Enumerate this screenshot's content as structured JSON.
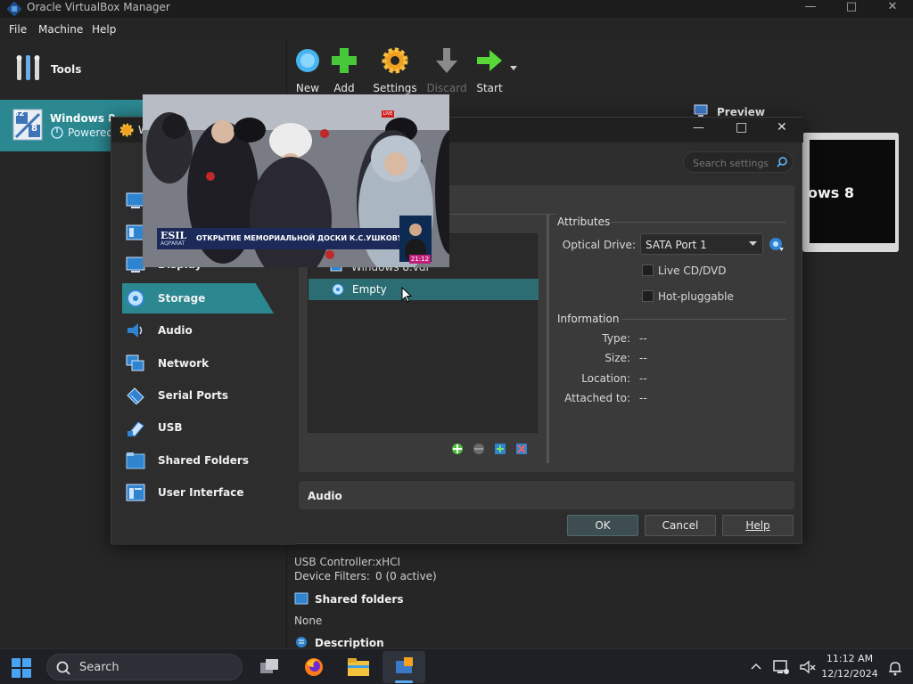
{
  "window": {
    "title": "Oracle VirtualBox Manager",
    "minimize_icon": "minimize-icon",
    "maximize_icon": "maximize-icon",
    "close_icon": "close-icon"
  },
  "menu": {
    "file": "File",
    "machine": "Machine",
    "help": "Help"
  },
  "left": {
    "tools_label": "Tools",
    "vm_name": "Windows 8",
    "vm_state": "Powered",
    "vm_badge_top": "32",
    "vm_badge_bottom": "8"
  },
  "toolbar": {
    "new": "New",
    "add": "Add",
    "settings": "Settings",
    "discard": "Discard",
    "start": "Start"
  },
  "preview": {
    "label": "Preview",
    "screen_text": "ows 8"
  },
  "details": {
    "usb_controller_label": "USB Controller:",
    "usb_controller_value": "xHCI",
    "device_filters_label": "Device Filters:",
    "device_filters_value": "0 (0 active)",
    "shared_folders_head": "Shared folders",
    "shared_folders_value": "None",
    "description_head": "Description"
  },
  "dialog": {
    "title_partial": "W",
    "search_placeholder": "Search settings",
    "mode_button_partial": "B",
    "nav": {
      "display": "Display",
      "storage": "Storage",
      "audio": "Audio",
      "network": "Network",
      "serial_ports": "Serial Ports",
      "usb": "USB",
      "shared_folders": "Shared Folders",
      "user_interface": "User Interface"
    },
    "storage": {
      "tree_item_disk": "Windows 8.vdi",
      "tree_item_empty": "Empty",
      "attributes_head": "Attributes",
      "optical_drive_label": "Optical Drive:",
      "optical_drive_value": "SATA Port 1",
      "live_cd_label": "Live CD/DVD",
      "hot_pluggable_label": "Hot-pluggable",
      "information_head": "Information",
      "type_label": "Type:",
      "type_value": "--",
      "size_label": "Size:",
      "size_value": "--",
      "location_label": "Location:",
      "location_value": "--",
      "attached_label": "Attached to:",
      "attached_value": "--"
    },
    "audio_head": "Audio",
    "ok": "OK",
    "cancel": "Cancel",
    "help": "Help"
  },
  "video": {
    "channel_name": "ESIL",
    "channel_sub": "AQPARAT",
    "ticker": "ОТКРЫТИЕ МЕМОРИАЛЬНОЙ ДОСКИ К.С.УШКОВУ",
    "clock": "21:12",
    "live_badge": "LIVE"
  },
  "taskbar": {
    "search": "Search",
    "time": "11:12 AM",
    "date": "12/12/2024"
  },
  "colors": {
    "accent": "#2b8891",
    "selection": "#2b6d73"
  }
}
